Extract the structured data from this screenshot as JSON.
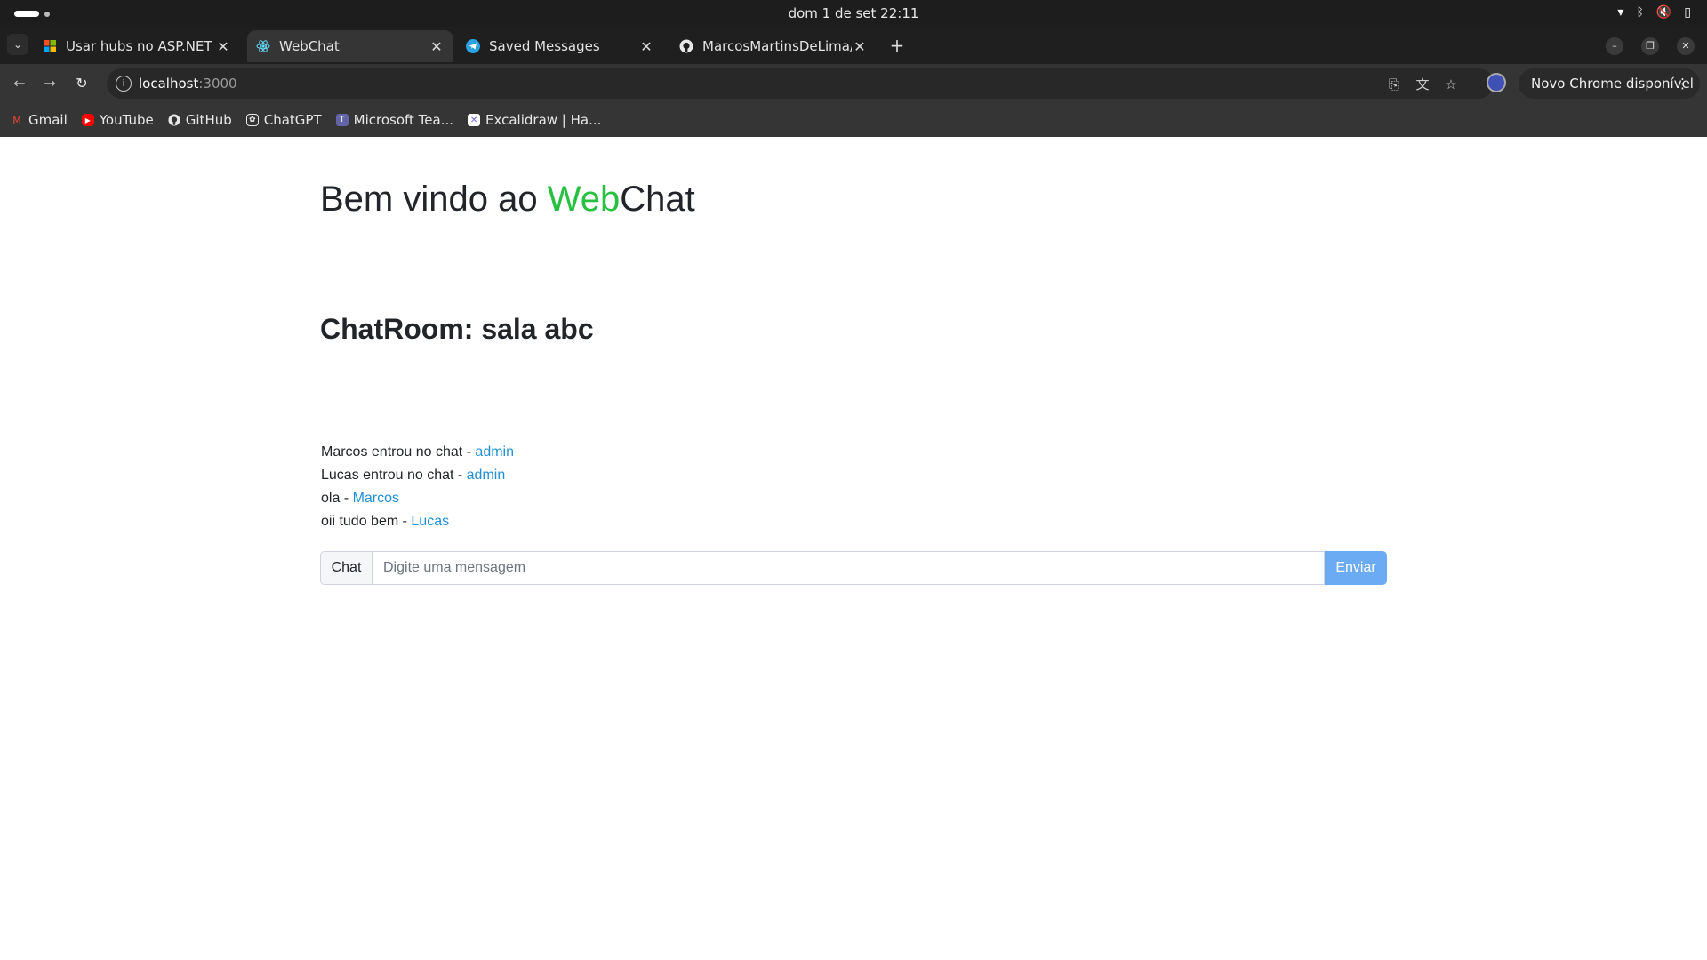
{
  "system": {
    "clock": "dom 1 de set  22:11"
  },
  "tabs": [
    {
      "title": "Usar hubs no ASP.NET Co",
      "icon": "microsoft-icon",
      "active": false
    },
    {
      "title": "WebChat",
      "icon": "react-icon",
      "active": true
    },
    {
      "title": "Saved Messages",
      "icon": "telegram-icon",
      "active": false
    },
    {
      "title": "MarcosMartinsDeLima/W",
      "icon": "github-icon",
      "active": false
    }
  ],
  "toolbar": {
    "url_host": "localhost",
    "url_port": ":3000",
    "update_label": "Novo Chrome disponível"
  },
  "bookmarks": [
    {
      "label": "Gmail",
      "icon": "gmail-icon",
      "color": "#ea4335"
    },
    {
      "label": "YouTube",
      "icon": "youtube-icon",
      "color": "#ff0000"
    },
    {
      "label": "GitHub",
      "icon": "github-icon",
      "color": "#ffffff"
    },
    {
      "label": "ChatGPT",
      "icon": "chatgpt-icon",
      "color": "#ffffff"
    },
    {
      "label": "Microsoft Tea...",
      "icon": "teams-icon",
      "color": "#6264a7"
    },
    {
      "label": "Excalidraw | Ha...",
      "icon": "excalidraw-icon",
      "color": "#6965db"
    }
  ],
  "page": {
    "welcome_prefix": "Bem vindo ao ",
    "welcome_web": "Web",
    "welcome_chat": "Chat",
    "room_title": "ChatRoom: sala abc",
    "messages": [
      {
        "text": "Marcos entrou no chat - ",
        "user": "admin"
      },
      {
        "text": "Lucas entrou no chat - ",
        "user": "admin"
      },
      {
        "text": "ola - ",
        "user": "Marcos"
      },
      {
        "text": "oii tudo bem - ",
        "user": "Lucas"
      }
    ],
    "chat_label": "Chat",
    "input_placeholder": "Digite uma mensagem",
    "send_label": "Enviar"
  },
  "colors": {
    "accent_green": "#28c040",
    "link_blue": "#1f8fd8",
    "send_button": "#6aabf4"
  }
}
